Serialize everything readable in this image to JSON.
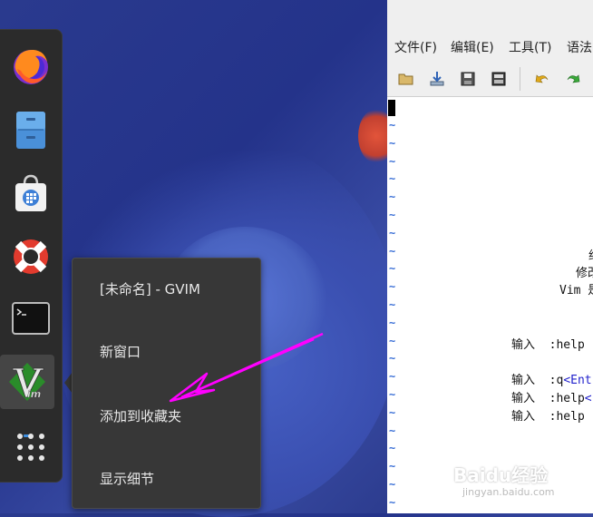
{
  "dock": {
    "items": [
      {
        "name": "firefox"
      },
      {
        "name": "file-cabinet"
      },
      {
        "name": "software-store"
      },
      {
        "name": "help-lifebuoy"
      },
      {
        "name": "terminal"
      },
      {
        "name": "gvim",
        "active": true
      },
      {
        "name": "app-grid"
      }
    ]
  },
  "context_menu": {
    "title": "[未命名] - GVIM",
    "items": [
      "新窗口",
      "添加到收藏夹",
      "显示细节"
    ]
  },
  "gvim": {
    "menubar": [
      "文件(F)",
      "编辑(E)",
      "工具(T)",
      "语法"
    ],
    "intro_lines": [
      {
        "prefix": "输入  :help ",
        "kw": "",
        "suffix": ""
      },
      {
        "prefix": "输入  :q",
        "kw": "<Ent",
        "suffix": ""
      },
      {
        "prefix": "输入  :help",
        "kw": "<",
        "suffix": ""
      },
      {
        "prefix": "输入  :help ",
        "kw": "",
        "suffix": ""
      }
    ],
    "partial_1": "约",
    "partial_2": "修改",
    "partial_3": "Vim 是"
  },
  "watermark": {
    "main": "Baidu经验",
    "sub": "jingyan.baidu.com"
  },
  "colors": {
    "accent": "#ff00ff",
    "tilde": "#3a6fd6",
    "keyword": "#2222cc"
  }
}
